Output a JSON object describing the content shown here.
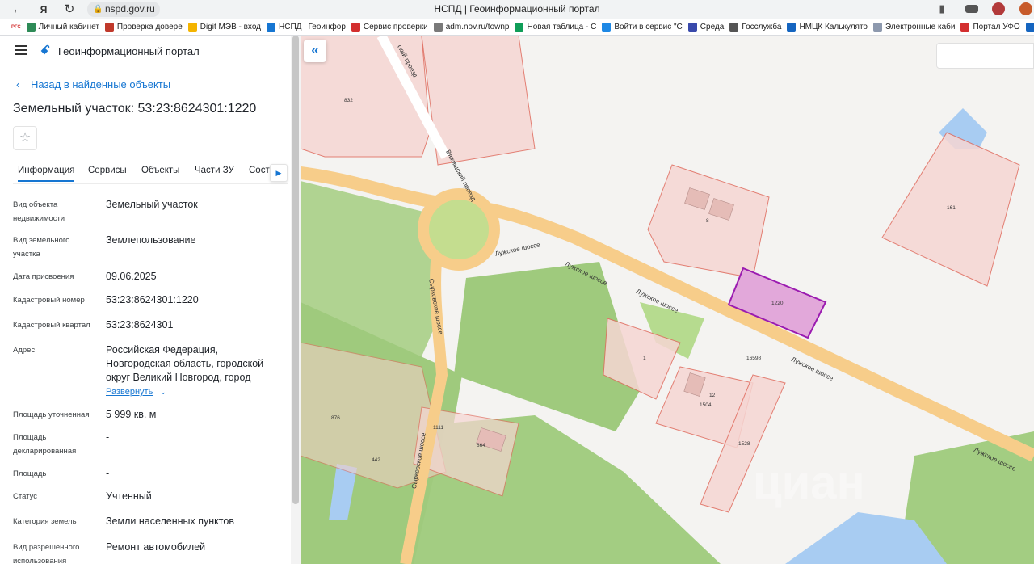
{
  "browser": {
    "url": "nspd.gov.ru",
    "window_title": "НСПД | Геоинформационный портал",
    "bookmarks": [
      {
        "label": "Личный кабинет",
        "color": "#2e8b57"
      },
      {
        "label": "Проверка довере",
        "color": "#c0392b"
      },
      {
        "label": "Digit МЭВ - вход",
        "color": "#f4b400"
      },
      {
        "label": "НСПД | Геоинфор",
        "color": "#1676d2"
      },
      {
        "label": "Сервис проверки",
        "color": "#d32f2f"
      },
      {
        "label": "adm.nov.ru/townp",
        "color": "#7a7a7a"
      },
      {
        "label": "Новая таблица - С",
        "color": "#0f9d58"
      },
      {
        "label": "Войти в сервис \"С",
        "color": "#1e88e5"
      },
      {
        "label": "Среда",
        "color": "#3949ab"
      },
      {
        "label": "Госслужба",
        "color": "#555555"
      },
      {
        "label": "НМЦК Калькулято",
        "color": "#1565c0"
      },
      {
        "label": "Электронные каби",
        "color": "#8d99ae"
      },
      {
        "label": "Портал УФО",
        "color": "#d32f2f"
      },
      {
        "label": "Пл",
        "color": "#1565c0"
      }
    ],
    "bookmark_prefix": "РГС"
  },
  "panel": {
    "app_title": "Геоинформационный портал",
    "back_label": "Назад в найденные объекты",
    "object_title": "Земельный участок: 53:23:8624301:1220",
    "tabs": [
      "Информация",
      "Сервисы",
      "Объекты",
      "Части ЗУ",
      "Соста"
    ],
    "properties": [
      {
        "key": "Вид объекта недвижимости",
        "value": "Земельный участок"
      },
      {
        "key": "Вид земельного участка",
        "value": "Землепользование"
      },
      {
        "key": "Дата присвоения",
        "value": "09.06.2025"
      },
      {
        "key": "Кадастровый номер",
        "value": "53:23:8624301:1220"
      },
      {
        "key": "Кадастровый квартал",
        "value": "53:23:8624301"
      },
      {
        "key": "Адрес",
        "value": "Российская Федерация, Новгородская область, городской округ Великий Новгород, город"
      },
      {
        "key": "Площадь уточненная",
        "value": "5 999 кв. м"
      },
      {
        "key": "Площадь декларированная",
        "value": "-"
      },
      {
        "key": "Площадь",
        "value": "-"
      },
      {
        "key": "Статус",
        "value": "Учтенный"
      },
      {
        "key": "Категория земель",
        "value": "Земли населенных пунктов"
      },
      {
        "key": "Вид разрешенного использования",
        "value": "Ремонт автомобилей"
      }
    ],
    "expand_label": "Развернуть"
  },
  "map": {
    "parcel_labels": [
      "832",
      "161",
      "1220",
      "16598",
      "1504",
      "1528",
      "876",
      "1111",
      "864",
      "442",
      "8",
      "1",
      "12"
    ],
    "road_labels": [
      "Лужское шоссе",
      "Лужское шоссе",
      "Лужское шоссе",
      "Лужское шоссе",
      "Лужское шоссе",
      "Сырковское шоссе",
      "Сырковское шоссе",
      "Вяжищский проезд",
      "ский проезд"
    ],
    "watermark": "циан",
    "selected_color": "#9b1bb0"
  }
}
